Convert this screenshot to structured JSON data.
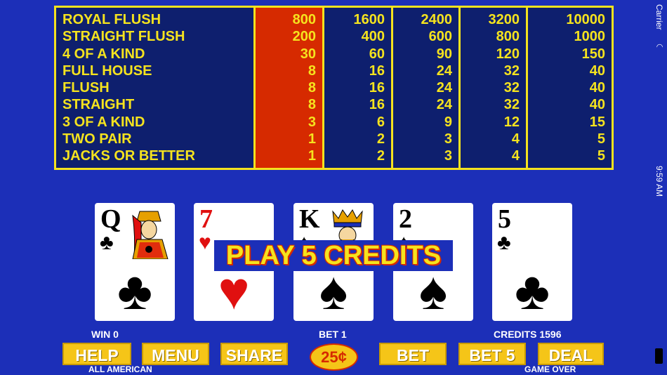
{
  "paytable": {
    "hands": [
      "ROYAL FLUSH",
      "STRAIGHT FLUSH",
      "4 OF A KIND",
      "FULL HOUSE",
      "FLUSH",
      "STRAIGHT",
      "3 OF A KIND",
      "TWO PAIR",
      "JACKS OR BETTER"
    ],
    "columns": [
      [
        "800",
        "200",
        "30",
        "8",
        "8",
        "8",
        "3",
        "1",
        "1"
      ],
      [
        "1600",
        "400",
        "60",
        "16",
        "16",
        "16",
        "6",
        "2",
        "2"
      ],
      [
        "2400",
        "600",
        "90",
        "24",
        "24",
        "24",
        "9",
        "3",
        "3"
      ],
      [
        "3200",
        "800",
        "120",
        "32",
        "32",
        "32",
        "12",
        "4",
        "4"
      ],
      [
        "10000",
        "1000",
        "150",
        "40",
        "40",
        "40",
        "15",
        "5",
        "5"
      ]
    ],
    "highlight_color": "#d62a00"
  },
  "status_bar": {
    "carrier": "Carrier",
    "time": "9:59 AM"
  },
  "cards": [
    {
      "rank": "Q",
      "suit": "♣",
      "color": "black",
      "face": "queen-of-clubs"
    },
    {
      "rank": "7",
      "suit": "♥",
      "color": "red"
    },
    {
      "rank": "K",
      "suit": "♠",
      "color": "black",
      "face": "king-of-spades"
    },
    {
      "rank": "2",
      "suit": "♠",
      "color": "black"
    },
    {
      "rank": "5",
      "suit": "♣",
      "color": "black"
    }
  ],
  "banner": "PLAY 5 CREDITS",
  "info": {
    "win": "WIN 0",
    "bet": "BET 1",
    "credits": "CREDITS 1596",
    "game_name": "ALL AMERICAN",
    "state": "GAME OVER"
  },
  "buttons": {
    "help": "HELP",
    "menu": "MENU",
    "share": "SHARE",
    "coin": "25¢",
    "bet": "BET",
    "bet5": "BET 5",
    "deal": "DEAL"
  }
}
